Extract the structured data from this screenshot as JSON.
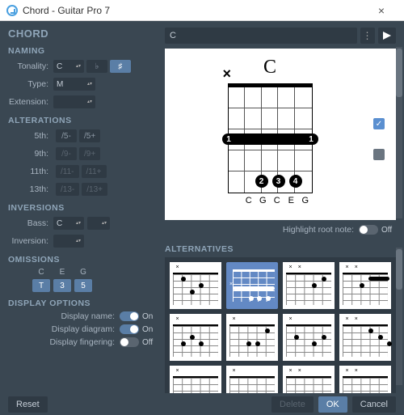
{
  "window": {
    "title": "Chord - Guitar Pro 7"
  },
  "headers": {
    "chord": "CHORD",
    "naming": "NAMING",
    "alterations": "ALTERATIONS",
    "inversions": "INVERSIONS",
    "omissions": "OMISSIONS",
    "display": "DISPLAY OPTIONS",
    "alternatives": "ALTERNATIVES"
  },
  "naming": {
    "tonality_label": "Tonality:",
    "tonality": "C",
    "flat": "♭",
    "sharp": "♯",
    "type_label": "Type:",
    "type": "M",
    "extension_label": "Extension:",
    "extension": ""
  },
  "alterations": {
    "r5_label": "5th:",
    "r5_minus": "/5-",
    "r5_plus": "/5+",
    "r9_label": "9th:",
    "r9_minus": "/9-",
    "r9_plus": "/9+",
    "r11_label": "11th:",
    "r11_minus": "/11-",
    "r11_plus": "/11+",
    "r13_label": "13th:",
    "r13_minus": "/13-",
    "r13_plus": "/13+"
  },
  "inversions": {
    "bass_label": "Bass:",
    "bass": "C",
    "inv_label": "Inversion:",
    "inv": ""
  },
  "omissions": {
    "cols": [
      {
        "h": "C",
        "v": "T"
      },
      {
        "h": "E",
        "v": "3"
      },
      {
        "h": "G",
        "v": "5"
      }
    ]
  },
  "display": {
    "name_label": "Display name:",
    "name_on": true,
    "name_state": "On",
    "diag_label": "Display diagram:",
    "diag_on": true,
    "diag_state": "On",
    "fing_label": "Display fingering:",
    "fing_on": false,
    "fing_state": "Off"
  },
  "chord_input": "C",
  "diagram": {
    "name": "C",
    "strings": [
      "",
      "C",
      "G",
      "C",
      "E",
      "G"
    ],
    "mute_string": 0,
    "barre": {
      "fret": 3,
      "from": 0,
      "to": 5,
      "finger": "1"
    },
    "dots": [
      {
        "s": 2,
        "f": 5,
        "n": "2"
      },
      {
        "s": 3,
        "f": 5,
        "n": "3"
      },
      {
        "s": 4,
        "f": 5,
        "n": "4"
      }
    ]
  },
  "highlight": {
    "label": "Highlight root note:",
    "on": false,
    "state": "Off"
  },
  "footer": {
    "reset": "Reset",
    "delete": "Delete",
    "ok": "OK",
    "cancel": "Cancel"
  }
}
